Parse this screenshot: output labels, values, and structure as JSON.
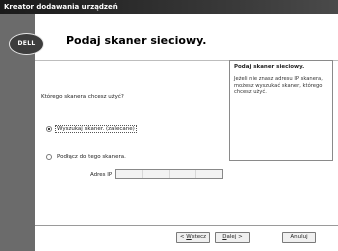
{
  "window": {
    "title": "Kreator dodawania urządzeń"
  },
  "brand": {
    "logo_text": "DELL"
  },
  "page": {
    "heading": "Podaj skaner sieciowy.",
    "question": "Którego skanera chcesz użyć?"
  },
  "help": {
    "title": "Podaj skaner sieciowy.",
    "text": "Jeżeli nie znasz adresu IP skanera, możesz wyszukać skaner, którego chcesz użyć."
  },
  "options": {
    "search": {
      "label": "Wyszukaj skaner. (zalecane)",
      "selected": true
    },
    "connect": {
      "label": "Podłącz do tego skanera.",
      "selected": false
    }
  },
  "ip": {
    "label": "Adres IP",
    "value": ""
  },
  "buttons": {
    "back": {
      "prefix": "< ",
      "underlined": "W",
      "rest": "stecz"
    },
    "next": {
      "underlined": "D",
      "rest": "alej >"
    },
    "cancel": {
      "label": "Anuluj"
    }
  }
}
